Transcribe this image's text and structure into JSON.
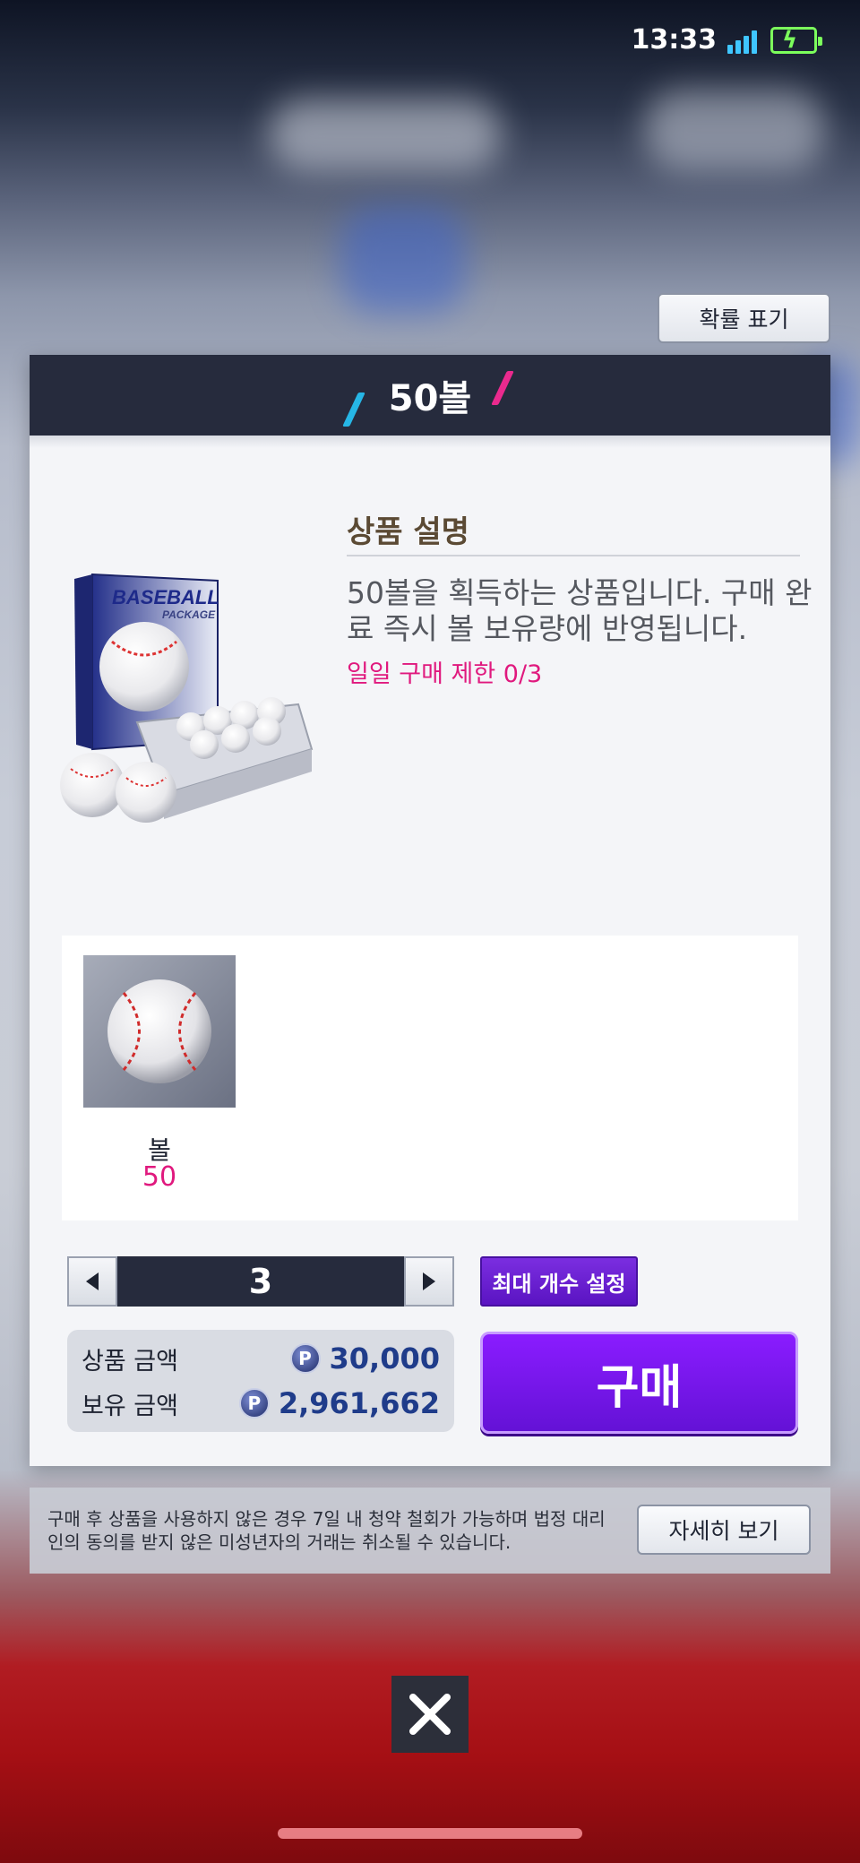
{
  "status_bar": {
    "time": "13:33"
  },
  "probability_button": {
    "label": "확률 표기"
  },
  "panel": {
    "title": "50볼",
    "description_heading": "상품 설명",
    "description": "50볼을 획득하는 상품입니다. 구매 완료 즉시 볼 보유량에 반영됩니다.",
    "daily_limit": "일일 구매 제한 0/3",
    "package_art": {
      "line1": "BASEBALL",
      "line2": "PACKAGE"
    },
    "reward": {
      "name": "볼",
      "quantity": "50"
    },
    "quantity": "3",
    "max_button": "최대 개수 설정",
    "price_label": "상품 금액",
    "price_value": "30,000",
    "owned_label": "보유 금액",
    "owned_value": "2,961,662",
    "buy_button": "구매",
    "currency_symbol": "P"
  },
  "notice": {
    "text": "구매 후 상품을 사용하지 않은 경우 7일 내 청약 철회가 가능하며 법정 대리인의 동의를 받지 않은 미성년자의 거래는 취소될 수 있습니다.",
    "detail_button": "자세히 보기"
  },
  "icons": {
    "close": "close-icon",
    "left": "arrow-left-icon",
    "right": "arrow-right-icon"
  },
  "colors": {
    "accent_purple": "#7a1cf0",
    "highlight_pink": "#e0197e",
    "header_navy": "#262b3d"
  }
}
